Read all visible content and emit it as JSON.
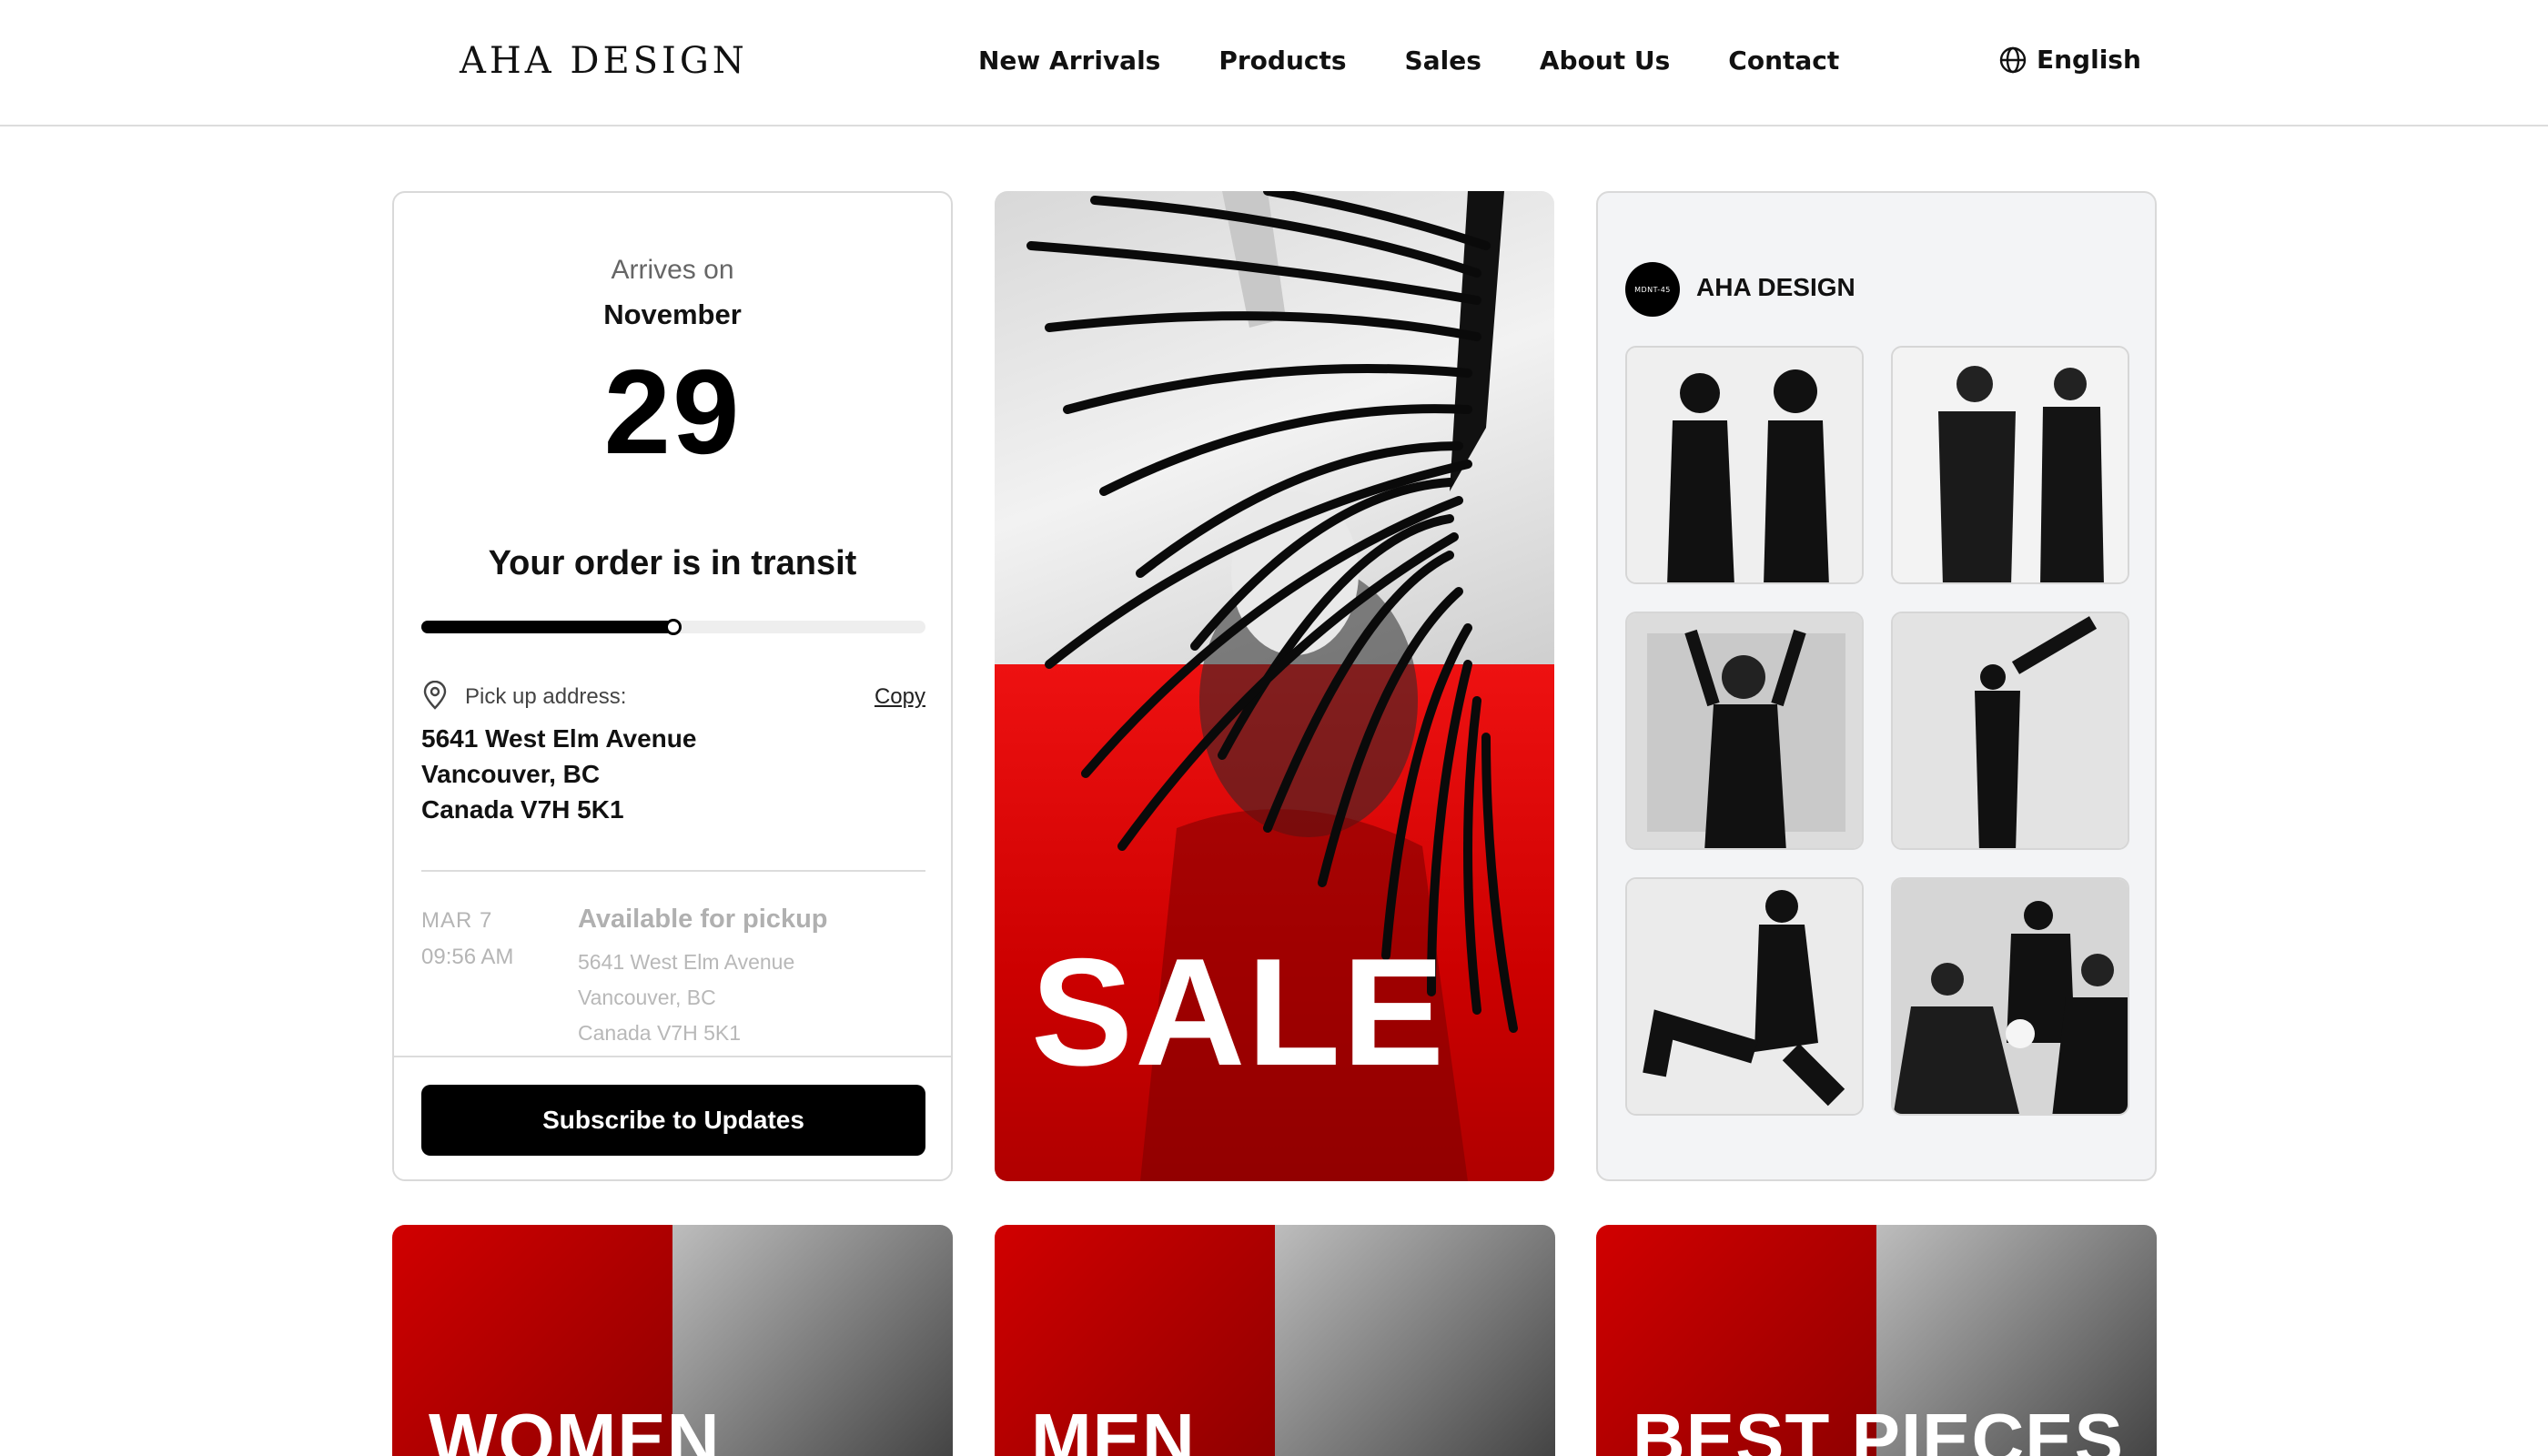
{
  "header": {
    "logo": "AHA DESIGN",
    "nav": [
      "New Arrivals",
      "Products",
      "Sales",
      "About Us",
      "Contact"
    ],
    "language": "English",
    "language_icon": "globe-icon"
  },
  "order": {
    "arrives_label": "Arrives on",
    "month": "November",
    "day": "29",
    "status": "Your order is in transit",
    "progress": 0.5,
    "pickup_label": "Pick up address:",
    "copy_label": "Copy",
    "address": [
      "5641 West Elm Avenue",
      "Vancouver, BC",
      "Canada V7H 5K1"
    ],
    "history": {
      "date": "MAR 7",
      "time": "09:56 AM",
      "title": "Available for pickup",
      "address": [
        "5641 West Elm Avenue",
        "Vancouver, BC",
        "Canada V7H 5K1"
      ]
    },
    "subscribe_label": "Subscribe to Updates"
  },
  "sale": {
    "text": "SALE",
    "colors": {
      "red": "#d40000",
      "white": "#ffffff"
    }
  },
  "instagram": {
    "avatar_text": "MDNT-45",
    "name": "AHA DESIGN"
  },
  "categories": [
    "WOMEN",
    "MEN",
    "BEST PIECES"
  ]
}
